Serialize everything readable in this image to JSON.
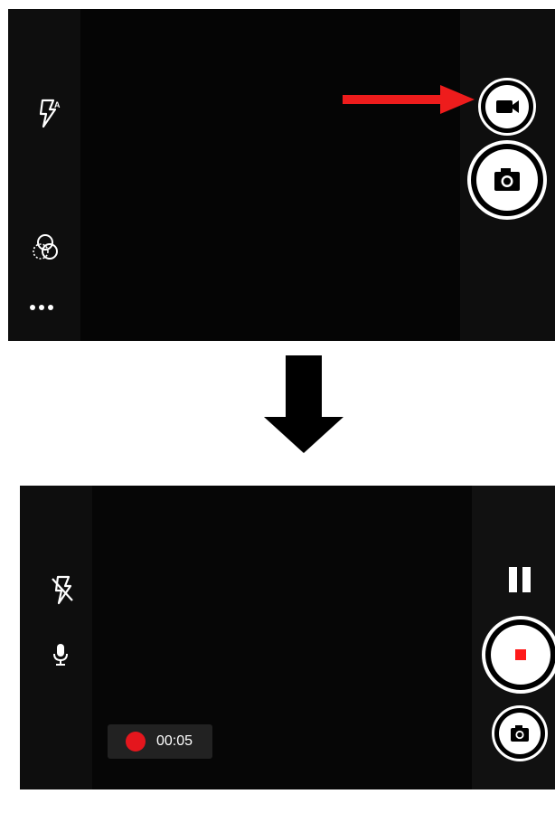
{
  "top_screen": {
    "left_controls": [
      {
        "name": "flash-auto",
        "icon": "flash-auto-icon"
      },
      {
        "name": "filter",
        "icon": "filter-overlap-circles-icon"
      },
      {
        "name": "more",
        "icon": "more-horiz-icon"
      }
    ],
    "right_controls": [
      {
        "name": "video-mode",
        "icon": "videocam-icon"
      },
      {
        "name": "shutter",
        "icon": "camera-icon"
      }
    ],
    "annotation_arrow_color": "#ee1c1c"
  },
  "transition_arrow_color": "#000000",
  "bottom_screen": {
    "left_controls": [
      {
        "name": "flash-off",
        "icon": "flash-off-icon"
      },
      {
        "name": "mic",
        "icon": "mic-icon"
      }
    ],
    "right_controls": [
      {
        "name": "pause",
        "icon": "pause-icon"
      },
      {
        "name": "stop-record",
        "icon": "stop-square-icon",
        "color": "#ff1a1a"
      },
      {
        "name": "snapshot",
        "icon": "camera-icon"
      }
    ],
    "recording": {
      "indicator_color": "#e4161d",
      "elapsed": "00:05"
    }
  }
}
